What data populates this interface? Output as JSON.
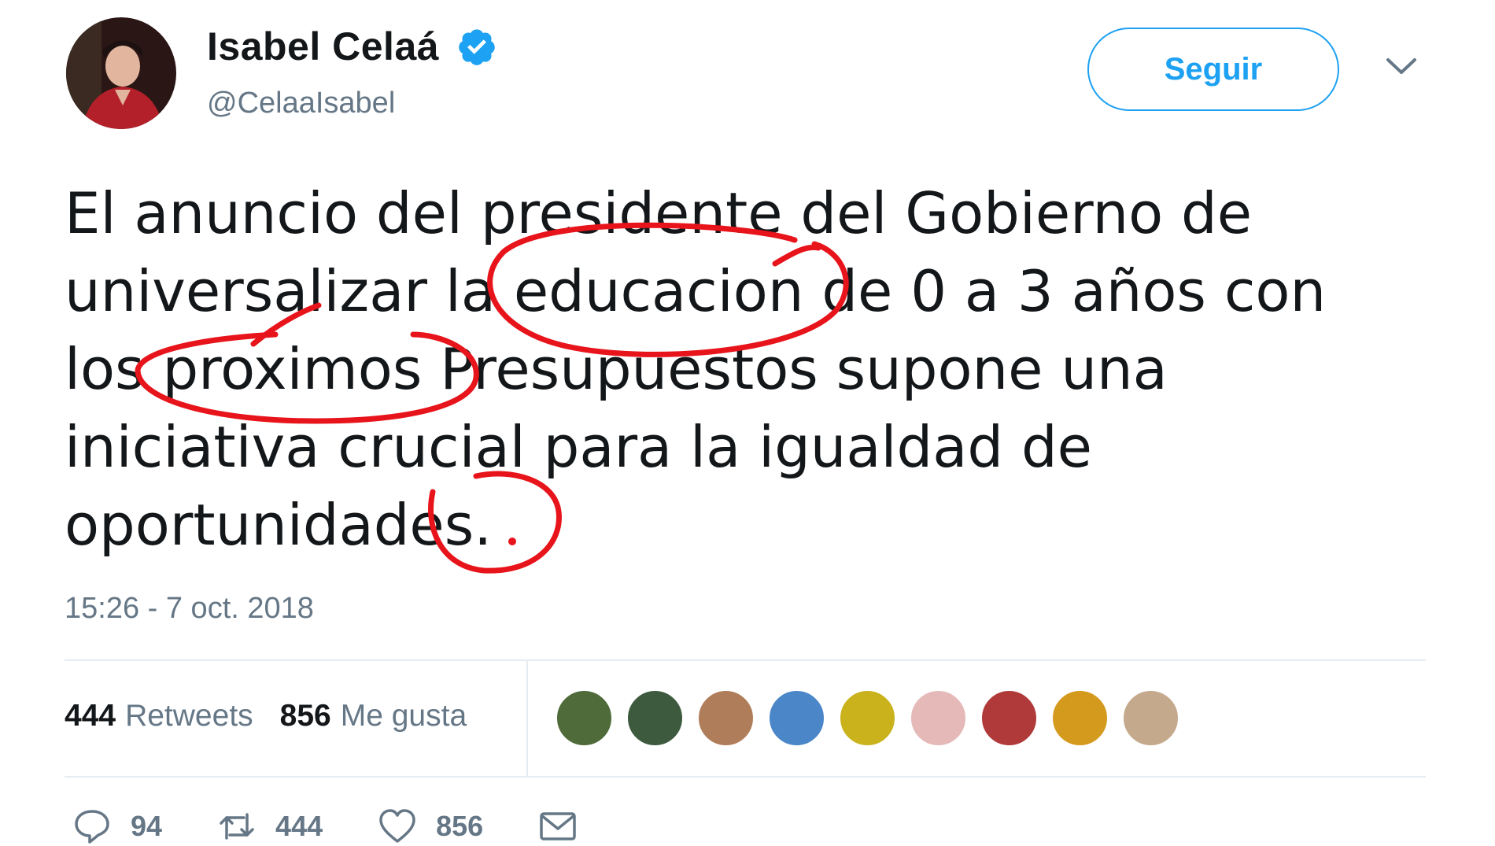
{
  "author": {
    "name": "Isabel Celaá",
    "handle": "@CelaaIsabel",
    "verified": true
  },
  "follow_button": {
    "label": "Seguir"
  },
  "tweet": {
    "lines": [
      "El anuncio del presidente del Gobierno de",
      "universalizar la educacion de 0 a 3 años con",
      "los proximos Presupuestos supone una",
      "iniciativa crucial para la igualdad de",
      "oportunidades."
    ],
    "timestamp": "15:26 - 7 oct. 2018"
  },
  "stats": {
    "retweets_count": "444",
    "retweets_label": "Retweets",
    "likes_count": "856",
    "likes_label": "Me gusta"
  },
  "liker_avatars": [
    {
      "name": "liker-1",
      "color": "#4f6b3a"
    },
    {
      "name": "liker-2",
      "color": "#3d5a3f"
    },
    {
      "name": "liker-3",
      "color": "#b07d5a"
    },
    {
      "name": "liker-4",
      "color": "#4a86c8"
    },
    {
      "name": "liker-5",
      "color": "#c9b21c"
    },
    {
      "name": "liker-6",
      "color": "#e6b9b9"
    },
    {
      "name": "liker-7",
      "color": "#b03a3a"
    },
    {
      "name": "liker-8",
      "color": "#d49a1e"
    },
    {
      "name": "liker-9",
      "color": "#c4a98c"
    }
  ],
  "actions": {
    "reply_count": "94",
    "retweet_count": "444",
    "like_count": "856"
  },
  "colors": {
    "accent": "#1da1f2",
    "muted": "#657786",
    "annotation": "#e8141b"
  }
}
